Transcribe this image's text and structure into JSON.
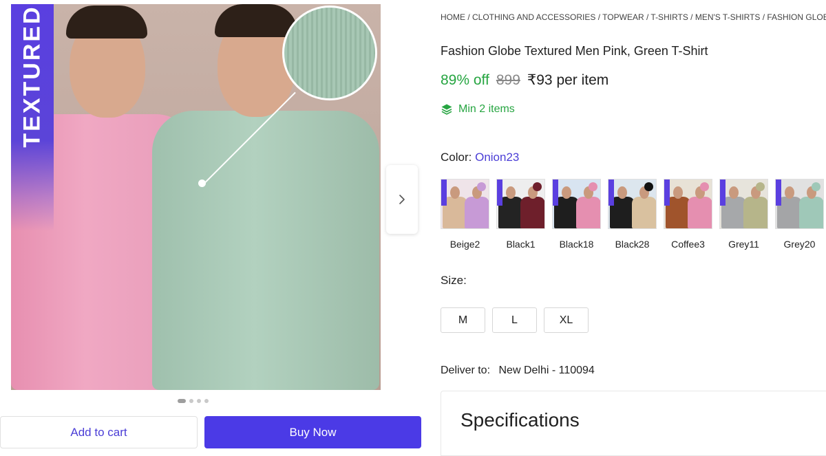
{
  "gallery": {
    "ribbon_text": "TEXTURED",
    "dots_count": 4,
    "active_dot": 1
  },
  "actions": {
    "add_to_cart": "Add to cart",
    "buy_now": "Buy Now"
  },
  "breadcrumb": "HOME / CLOTHING AND ACCESSORIES / TOPWEAR / T-SHIRTS / MEN'S T-SHIRTS / FASHION GLOBE",
  "product": {
    "title": "Fashion Globe Textured Men Pink, Green T-Shirt",
    "discount": "89% off",
    "mrp": "899",
    "price": "₹93 per item",
    "min_items": "Min 2 items"
  },
  "color": {
    "label": "Color:",
    "selected": "Onion23",
    "options": [
      {
        "label": "Beige2",
        "c1": "#d9b99a",
        "c2": "#c79ad6",
        "ball": "#c79ad6",
        "bg": "#efe4e9"
      },
      {
        "label": "Black1",
        "c1": "#232323",
        "c2": "#6e1f2b",
        "ball": "#6e1f2b",
        "bg": "#eee"
      },
      {
        "label": "Black18",
        "c1": "#1e1e1e",
        "c2": "#e58fb0",
        "ball": "#e58fb0",
        "bg": "#d8e4f1"
      },
      {
        "label": "Black28",
        "c1": "#1e1e1e",
        "c2": "#d9c19f",
        "ball": "#111111",
        "bg": "#dce6ee"
      },
      {
        "label": "Coffee3",
        "c1": "#a0542c",
        "c2": "#e58fb0",
        "ball": "#e58fb0",
        "bg": "#e8e2d6"
      },
      {
        "label": "Grey11",
        "c1": "#a6a8aa",
        "c2": "#b6b58a",
        "ball": "#b6b58a",
        "bg": "#e7e4dc"
      },
      {
        "label": "Grey20",
        "c1": "#a4a5a7",
        "c2": "#9fc8b8",
        "ball": "#9fc8b8",
        "bg": "#e1e1e1"
      }
    ]
  },
  "size": {
    "label": "Size:",
    "options": [
      "M",
      "L",
      "XL"
    ]
  },
  "delivery": {
    "label": "Deliver to:",
    "location": "New Delhi - 110094"
  },
  "specifications": {
    "title": "Specifications"
  },
  "icons": {
    "next": "chevron-right-icon",
    "min": "layers-icon"
  },
  "colors": {
    "accent": "#4b3ae6",
    "green": "#26a541"
  }
}
